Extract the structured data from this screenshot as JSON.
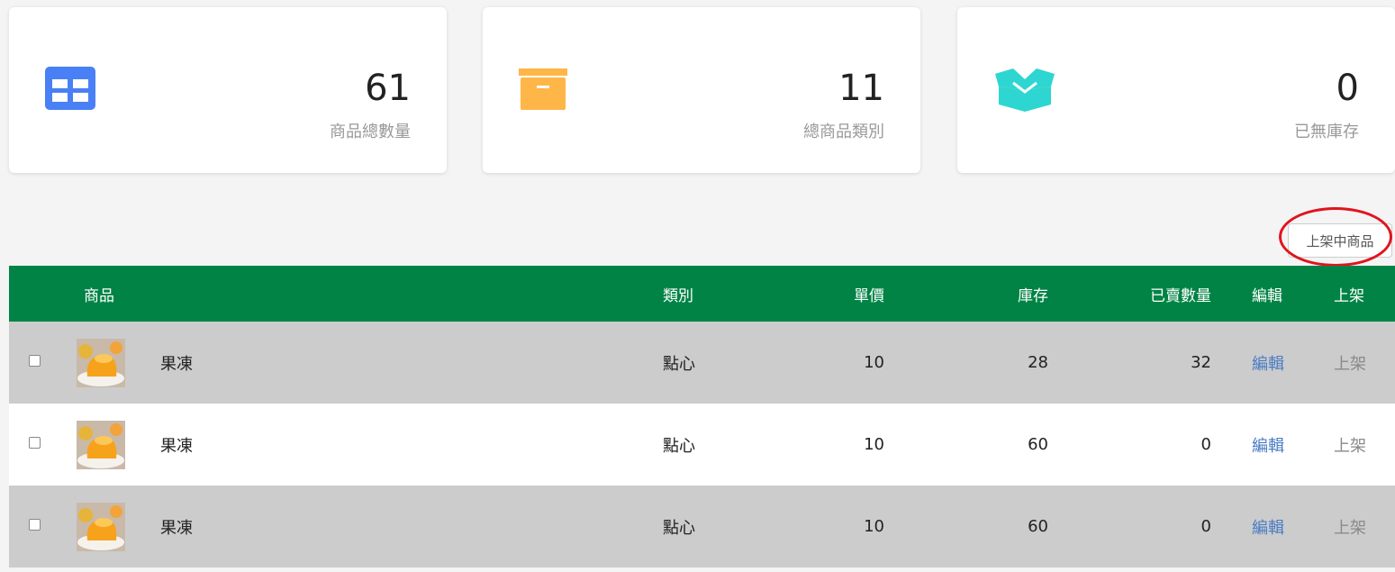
{
  "stats": [
    {
      "value": "61",
      "label": "商品總數量",
      "icon": "grid-icon",
      "color": "#4a80f5"
    },
    {
      "value": "11",
      "label": "總商品類別",
      "icon": "archive-box-icon",
      "color": "#ffb648"
    },
    {
      "value": "0",
      "label": "已無庫存",
      "icon": "open-box-icon",
      "color": "#2dd6d0"
    }
  ],
  "filter_button": "上架中商品",
  "table": {
    "headers": {
      "product": "商品",
      "category": "類別",
      "price": "單價",
      "stock": "庫存",
      "sold": "已賣數量",
      "edit": "編輯",
      "shelf": "上架"
    },
    "rows": [
      {
        "name": "果凍",
        "category": "點心",
        "price": "10",
        "stock": "28",
        "sold": "32",
        "edit": "編輯",
        "shelf": "上架"
      },
      {
        "name": "果凍",
        "category": "點心",
        "price": "10",
        "stock": "60",
        "sold": "0",
        "edit": "編輯",
        "shelf": "上架"
      },
      {
        "name": "果凍",
        "category": "點心",
        "price": "10",
        "stock": "60",
        "sold": "0",
        "edit": "編輯",
        "shelf": "上架"
      }
    ]
  },
  "colors": {
    "header_green": "#008345",
    "row_gray": "#cccccc",
    "highlight_ring": "#e0141e"
  }
}
